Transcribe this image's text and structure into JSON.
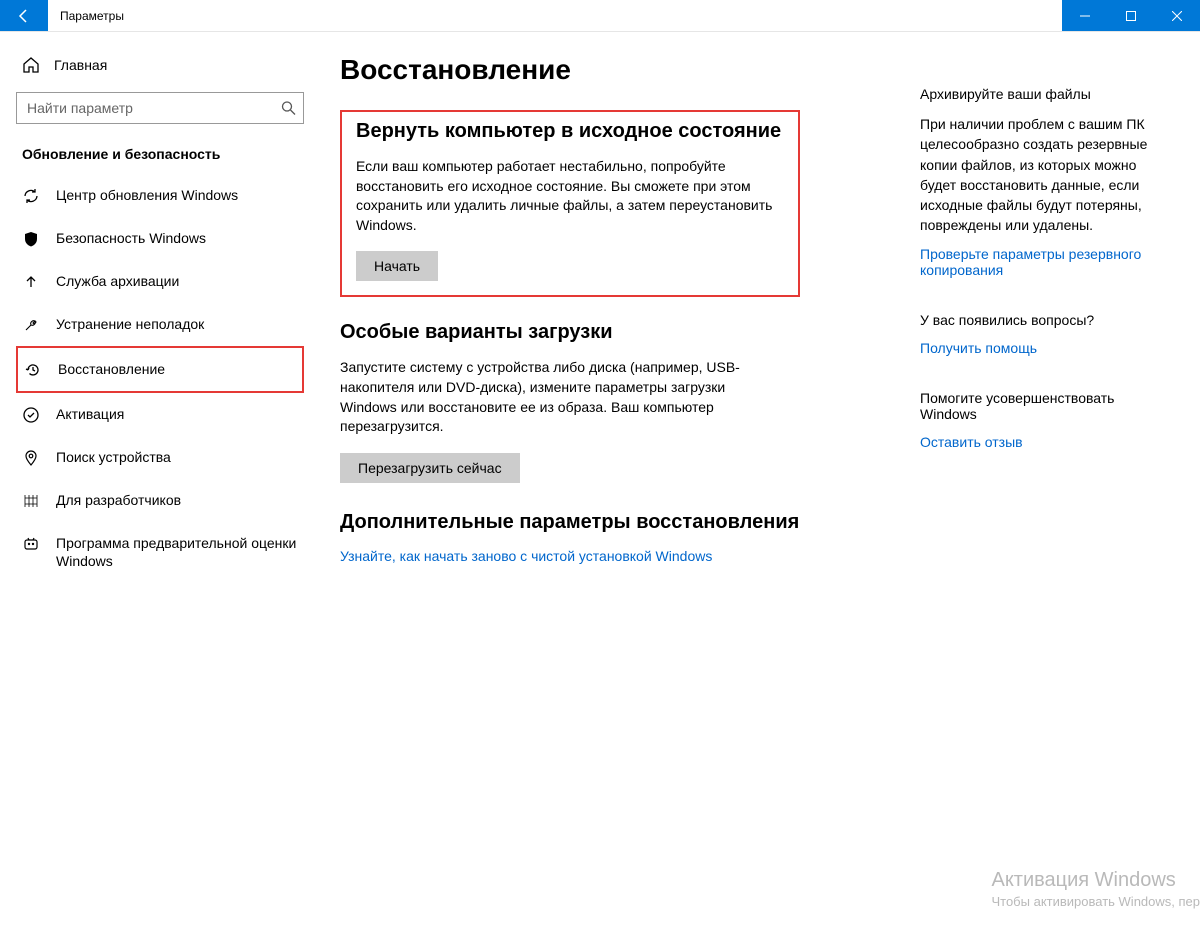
{
  "window": {
    "title": "Параметры"
  },
  "sidebar": {
    "home_label": "Главная",
    "search_placeholder": "Найти параметр",
    "section_title": "Обновление и безопасность",
    "items": [
      {
        "label": "Центр обновления Windows"
      },
      {
        "label": "Безопасность Windows"
      },
      {
        "label": "Служба архивации"
      },
      {
        "label": "Устранение неполадок"
      },
      {
        "label": "Восстановление"
      },
      {
        "label": "Активация"
      },
      {
        "label": "Поиск устройства"
      },
      {
        "label": "Для разработчиков"
      },
      {
        "label": "Программа предварительной оценки Windows"
      }
    ]
  },
  "page": {
    "title": "Восстановление",
    "reset": {
      "title": "Вернуть компьютер в исходное состояние",
      "text": "Если ваш компьютер работает нестабильно, попробуйте восстановить его исходное состояние. Вы сможете при этом сохранить или удалить личные файлы, а затем переустановить Windows.",
      "button": "Начать"
    },
    "startup": {
      "title": "Особые варианты загрузки",
      "text": "Запустите систему с устройства либо диска (например, USB-накопителя или DVD-диска), измените параметры загрузки Windows или восстановите ее из образа. Ваш компьютер перезагрузится.",
      "button": "Перезагрузить сейчас"
    },
    "more": {
      "title": "Дополнительные параметры восстановления",
      "link": "Узнайте, как начать заново с чистой установкой Windows"
    }
  },
  "right": {
    "backup": {
      "title": "Архивируйте ваши файлы",
      "text": "При наличии проблем с вашим ПК целесообразно создать резервные копии файлов, из которых можно будет восстановить данные, если исходные файлы будут потеряны, повреждены или удалены.",
      "link": "Проверьте параметры резервного копирования"
    },
    "questions": {
      "title": "У вас появились вопросы?",
      "link": "Получить помощь"
    },
    "improve": {
      "title": "Помогите усовершенствовать Windows",
      "link": "Оставить отзыв"
    }
  },
  "watermark": {
    "line1": "Активация Windows",
    "line2": "Чтобы активировать Windows, пер"
  }
}
